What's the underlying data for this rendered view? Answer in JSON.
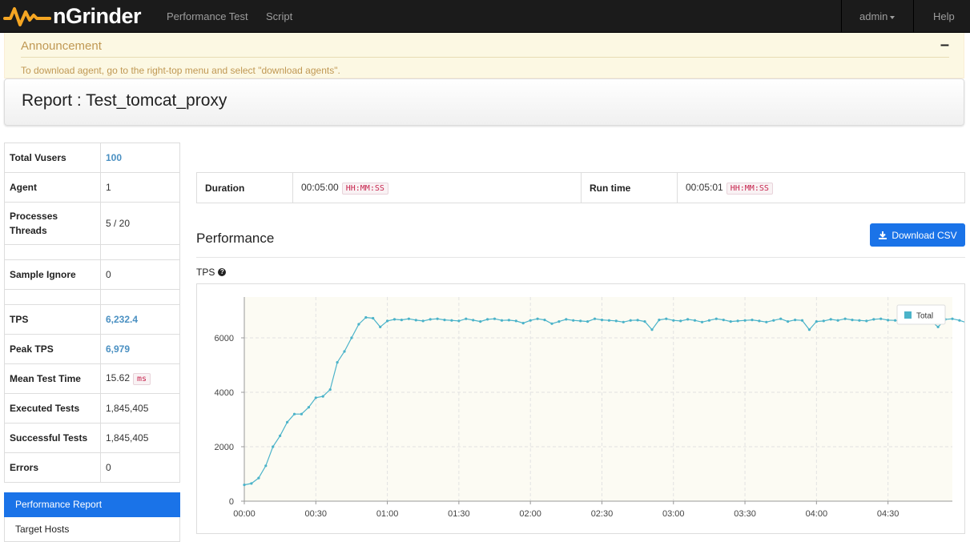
{
  "nav": {
    "brand": "nGrinder",
    "items": [
      "Performance Test",
      "Script"
    ],
    "user": "admin",
    "help": "Help"
  },
  "announcement": {
    "title": "Announcement",
    "toggle": "–",
    "text": "To download agent, go to the right-top menu and select \"download agents\"."
  },
  "report": {
    "title": "Report : Test_tomcat_proxy"
  },
  "summary": {
    "total_vusers": {
      "label": "Total Vusers",
      "value": "100"
    },
    "agent": {
      "label": "Agent",
      "value": "1"
    },
    "procs": {
      "label1": "Processes",
      "label2": "Threads",
      "value": "5 / 20"
    },
    "sample_ignore": {
      "label": "Sample Ignore",
      "value": "0"
    },
    "tps": {
      "label": "TPS",
      "value": "6,232.4"
    },
    "peak_tps": {
      "label": "Peak TPS",
      "value": "6,979"
    },
    "mean_test_time": {
      "label": "Mean Test Time",
      "value": "15.62",
      "unit": "ms"
    },
    "executed_tests": {
      "label": "Executed Tests",
      "value": "1,845,405"
    },
    "successful_tests": {
      "label": "Successful Tests",
      "value": "1,845,405"
    },
    "errors": {
      "label": "Errors",
      "value": "0"
    }
  },
  "side_menu": {
    "items": [
      "Performance Report",
      "Target Hosts"
    ],
    "active": "Performance Report"
  },
  "duration": {
    "duration_label": "Duration",
    "duration_value": "00:05:00",
    "duration_unit": "HH:MM:SS",
    "runtime_label": "Run time",
    "runtime_value": "00:05:01",
    "runtime_unit": "HH:MM:SS"
  },
  "performance": {
    "title": "Performance",
    "download_label": "Download CSV",
    "tps_label": "TPS"
  },
  "colors": {
    "primary": "#1a73e8",
    "series": "#4bb3c9",
    "navbar": "#1b1b1b",
    "brand_accent": "#f5a623"
  },
  "chart_data": {
    "type": "line",
    "title": "TPS",
    "series": [
      {
        "name": "Total",
        "x_seconds_step": 3,
        "values": [
          600,
          650,
          850,
          1300,
          2000,
          2400,
          2900,
          3200,
          3200,
          3450,
          3800,
          3850,
          4100,
          5100,
          5500,
          6000,
          6500,
          6750,
          6720,
          6400,
          6620,
          6680,
          6660,
          6700,
          6650,
          6620,
          6680,
          6700,
          6660,
          6640,
          6620,
          6700,
          6650,
          6600,
          6680,
          6700,
          6640,
          6650,
          6620,
          6540,
          6640,
          6700,
          6660,
          6520,
          6600,
          6680,
          6640,
          6620,
          6600,
          6700,
          6660,
          6640,
          6620,
          6580,
          6640,
          6650,
          6600,
          6300,
          6660,
          6700,
          6640,
          6620,
          6680,
          6640,
          6580,
          6640,
          6700,
          6660,
          6600,
          6620,
          6640,
          6660,
          6620,
          6580,
          6640,
          6700,
          6600,
          6660,
          6640,
          6300,
          6600,
          6620,
          6680,
          6640,
          6700,
          6660,
          6640,
          6620,
          6680,
          6700,
          6650,
          6640,
          6600,
          6700,
          6660,
          6640,
          6620,
          6400,
          6680,
          6700,
          6640,
          6560,
          6600,
          6650,
          6600,
          6700,
          6740,
          6620,
          6600,
          6640,
          6700,
          6660,
          6620,
          6580,
          6640,
          6700,
          6940,
          6660,
          6600,
          6640,
          6680,
          6700,
          6650,
          6300,
          6700,
          6680,
          6640,
          6620,
          6700,
          6660,
          6560,
          6600,
          6700,
          6640,
          6620,
          6600,
          6680,
          6700,
          6640,
          6560,
          6600,
          6700,
          6640,
          6580,
          6200,
          6640,
          6680,
          6700,
          6620,
          6560,
          6700
        ]
      }
    ],
    "x_ticks": [
      "00:00",
      "00:30",
      "01:00",
      "01:30",
      "02:00",
      "02:30",
      "03:00",
      "03:30",
      "04:00",
      "04:30"
    ],
    "y_ticks": [
      0,
      2000,
      4000,
      6000
    ],
    "ylim": [
      0,
      7500
    ],
    "xlim_seconds": [
      0,
      297
    ],
    "legend": "top-right",
    "grid": true
  }
}
